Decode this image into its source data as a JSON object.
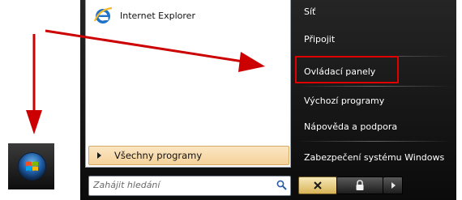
{
  "start_orb": {
    "icon": "windows-logo-icon"
  },
  "left_pane": {
    "pinned": [
      {
        "label": "Internet Explorer",
        "icon": "internet-explorer-icon"
      }
    ],
    "all_programs_label": "Všechny programy"
  },
  "search": {
    "placeholder": "Zahájit hledání",
    "icon": "search-icon"
  },
  "right_pane": {
    "items": [
      {
        "label": "Síť"
      },
      {
        "label": "Připojit"
      },
      {
        "label": "Ovládací panely",
        "highlighted": true
      },
      {
        "label": "Výchozí programy"
      },
      {
        "label": "Nápověda a podpora"
      },
      {
        "label": "Zabezpečení systému Windows"
      }
    ]
  },
  "buttons": {
    "shutdown_icon": "close-icon",
    "lock_icon": "lock-icon",
    "more_icon": "arrow-right-icon"
  },
  "colors": {
    "highlight": "#e00000",
    "arrow": "#cc0000",
    "all_programs_bg": "#f5d29a"
  }
}
